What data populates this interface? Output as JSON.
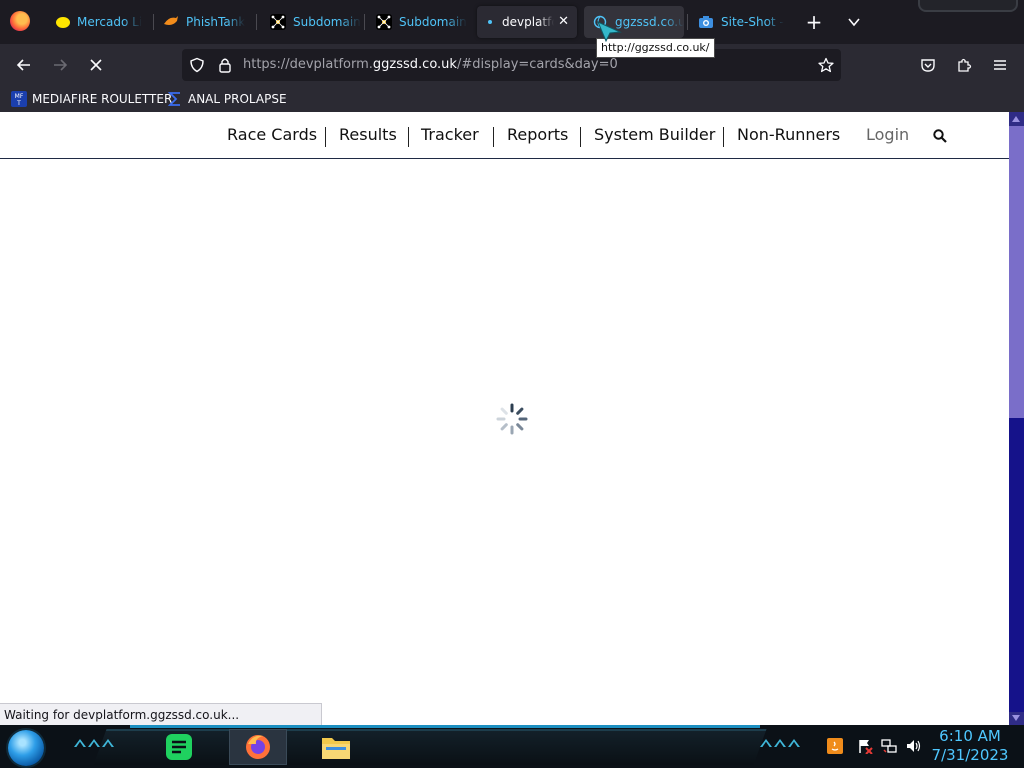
{
  "browser": {
    "tabs": [
      {
        "title": "Mercado Li",
        "icon": "mercadolibre-icon"
      },
      {
        "title": "PhishTank",
        "icon": "phishtank-icon"
      },
      {
        "title": "Subdomain",
        "icon": "subdomain-icon"
      },
      {
        "title": "Subdomain",
        "icon": "subdomain-icon"
      },
      {
        "title": "devplatfo",
        "icon": "loading-dot-icon",
        "active": true
      },
      {
        "title": "ggzssd.co.u",
        "icon": "globe-icon"
      },
      {
        "title": "Site-Shot -",
        "icon": "camera-icon"
      }
    ],
    "url": {
      "prefix": "https://devplatform.",
      "host": "ggzssd.co.uk",
      "path": "/#display=cards&day=0"
    },
    "bookmarks": [
      {
        "label": "MEDIAFIRE ROULETTER",
        "icon": "mediafire-icon"
      },
      {
        "label": "ANAL PROLAPSE",
        "icon": "sigma-icon"
      }
    ],
    "tooltip": "http://ggzssd.co.uk/",
    "status": "Waiting for devplatform.ggzssd.co.uk..."
  },
  "site": {
    "nav": [
      "Race Cards",
      "Results",
      "Tracker",
      "Reports",
      "System Builder",
      "Non-Runners"
    ],
    "login": "Login"
  },
  "taskbar": {
    "time": "6:10 AM",
    "date": "7/31/2023"
  },
  "colors": {
    "tab_text": "#4fc3f7",
    "toolbar_bg": "#2b2a33",
    "clock": "#4fc8ff",
    "scrollbar": "#2f2c86"
  }
}
